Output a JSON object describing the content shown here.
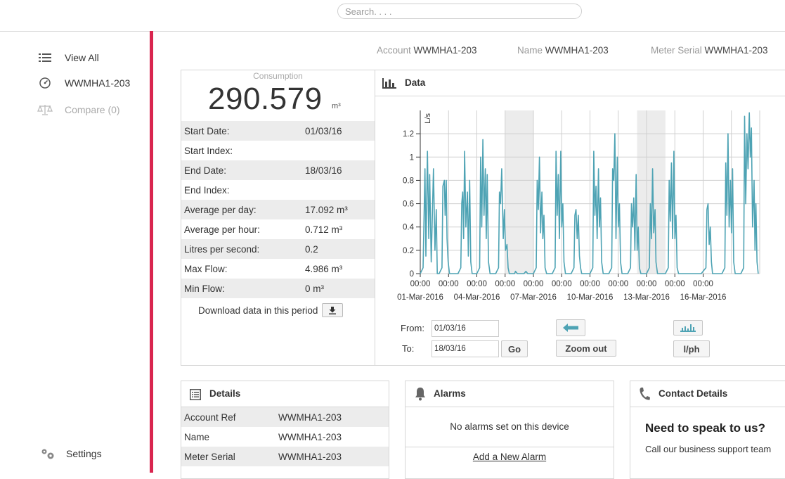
{
  "search": {
    "placeholder": "Search. . . ."
  },
  "sidebar": {
    "items": [
      {
        "label": "View All",
        "icon": "list-icon"
      },
      {
        "label": "WWMHA1-203",
        "icon": "gauge-icon"
      },
      {
        "label": "Compare (0)",
        "icon": "scales-icon"
      }
    ],
    "settings_label": "Settings",
    "accent_color": "#d9254f"
  },
  "meta": {
    "account_label": "Account",
    "account_value": "WWMHA1-203",
    "name_label": "Name",
    "name_value": "WWMHA1-203",
    "serial_label": "Meter Serial",
    "serial_value": "WWMHA1-203"
  },
  "consumption": {
    "label": "Consumption",
    "value": "290.579",
    "unit": "m³",
    "stats": [
      {
        "label": "Start Date:",
        "value": "01/03/16"
      },
      {
        "label": "Start Index:",
        "value": ""
      },
      {
        "label": "End Date:",
        "value": "18/03/16"
      },
      {
        "label": "End Index:",
        "value": ""
      },
      {
        "label": "Average per day:",
        "value": "17.092 m³"
      },
      {
        "label": "Average per hour:",
        "value": "0.712 m³"
      },
      {
        "label": "Litres per second:",
        "value": "0.2"
      },
      {
        "label": "Max Flow:",
        "value": "4.986 m³"
      },
      {
        "label": "Min Flow:",
        "value": "0 m³"
      }
    ],
    "download_label": "Download data in this period"
  },
  "data_panel": {
    "title": "Data",
    "from_label": "From:",
    "from_value": "01/03/16",
    "to_label": "To:",
    "to_value": "18/03/16",
    "go_label": "Go",
    "zoom_out_label": "Zoom out",
    "unit_toggle_label": "l/ph"
  },
  "chart_data": {
    "type": "line",
    "ylabel": "L/s",
    "ylim": [
      0,
      1.4
    ],
    "yticks": [
      0,
      0.2,
      0.4,
      0.6,
      0.8,
      1,
      1.2
    ],
    "xlim": [
      0,
      18
    ],
    "xticks": [
      {
        "top": "00:00",
        "bottom": "01-Mar-2016"
      },
      {
        "top": "00:00",
        "bottom": ""
      },
      {
        "top": "00:00",
        "bottom": "04-Mar-2016"
      },
      {
        "top": "00:00",
        "bottom": ""
      },
      {
        "top": "00:00",
        "bottom": "07-Mar-2016"
      },
      {
        "top": "00:00",
        "bottom": ""
      },
      {
        "top": "00:00",
        "bottom": "10-Mar-2016"
      },
      {
        "top": "00:00",
        "bottom": ""
      },
      {
        "top": "00:00",
        "bottom": "13-Mar-2016"
      },
      {
        "top": "00:00",
        "bottom": ""
      },
      {
        "top": "00:00",
        "bottom": "16-Mar-2016"
      }
    ],
    "weekend_bands": [
      [
        4.5,
        6
      ],
      [
        11.5,
        13
      ]
    ],
    "grid": true,
    "color": "#4ea3b4",
    "series": [
      {
        "values": [
          [
            0,
            0
          ],
          [
            0.15,
            0.05
          ],
          [
            0.25,
            0.9
          ],
          [
            0.3,
            0.15
          ],
          [
            0.38,
            1.05
          ],
          [
            0.45,
            0.3
          ],
          [
            0.5,
            0.85
          ],
          [
            0.58,
            0.1
          ],
          [
            0.7,
            0.9
          ],
          [
            0.78,
            0.2
          ],
          [
            0.85,
            0.55
          ],
          [
            0.9,
            0
          ],
          [
            1.0,
            0
          ],
          [
            1.15,
            0.05
          ],
          [
            1.2,
            0.75
          ],
          [
            1.28,
            0.8
          ],
          [
            1.32,
            0.5
          ],
          [
            1.38,
            0.8
          ],
          [
            1.42,
            0.3
          ],
          [
            1.48,
            0.1
          ],
          [
            1.55,
            0
          ],
          [
            2.0,
            0
          ],
          [
            2.15,
            0.05
          ],
          [
            2.2,
            0.6
          ],
          [
            2.25,
            0.7
          ],
          [
            2.3,
            0.3
          ],
          [
            2.35,
            1.05
          ],
          [
            2.42,
            0.4
          ],
          [
            2.5,
            0.7
          ],
          [
            2.55,
            0.15
          ],
          [
            2.62,
            0.8
          ],
          [
            2.68,
            0.1
          ],
          [
            2.75,
            0
          ],
          [
            3.0,
            0
          ],
          [
            3.15,
            0.05
          ],
          [
            3.2,
            1.0
          ],
          [
            3.26,
            0.4
          ],
          [
            3.32,
            1.15
          ],
          [
            3.38,
            0.5
          ],
          [
            3.45,
            0.9
          ],
          [
            3.5,
            0.3
          ],
          [
            3.55,
            0.85
          ],
          [
            3.62,
            0.1
          ],
          [
            3.7,
            0
          ],
          [
            4.0,
            0
          ],
          [
            4.15,
            0.05
          ],
          [
            4.2,
            0.7
          ],
          [
            4.26,
            0.6
          ],
          [
            4.32,
            0.9
          ],
          [
            4.4,
            0.3
          ],
          [
            4.46,
            0.55
          ],
          [
            4.52,
            0.2
          ],
          [
            4.6,
            0.25
          ],
          [
            4.66,
            0.05
          ],
          [
            4.72,
            0
          ],
          [
            5.0,
            0
          ],
          [
            5.05,
            0.02
          ],
          [
            5.15,
            0
          ],
          [
            5.5,
            0
          ],
          [
            5.6,
            0.02
          ],
          [
            5.7,
            0
          ],
          [
            6.0,
            0
          ],
          [
            6.15,
            0.05
          ],
          [
            6.2,
            0.8
          ],
          [
            6.26,
            0.55
          ],
          [
            6.32,
            1.0
          ],
          [
            6.38,
            0.35
          ],
          [
            6.45,
            0.7
          ],
          [
            6.5,
            0.3
          ],
          [
            6.56,
            0.5
          ],
          [
            6.62,
            0.05
          ],
          [
            6.7,
            0
          ],
          [
            7.0,
            0
          ],
          [
            7.15,
            0.05
          ],
          [
            7.2,
            1.05
          ],
          [
            7.26,
            0.5
          ],
          [
            7.32,
            0.85
          ],
          [
            7.38,
            0.3
          ],
          [
            7.45,
            1.05
          ],
          [
            7.5,
            0.4
          ],
          [
            7.56,
            0.6
          ],
          [
            7.62,
            0.1
          ],
          [
            7.7,
            0
          ],
          [
            8.0,
            0
          ],
          [
            8.15,
            0.05
          ],
          [
            8.2,
            0.5
          ],
          [
            8.26,
            0.55
          ],
          [
            8.32,
            0.3
          ],
          [
            8.38,
            0.5
          ],
          [
            8.44,
            0.15
          ],
          [
            8.5,
            0.05
          ],
          [
            8.56,
            0
          ],
          [
            9.0,
            0
          ],
          [
            9.15,
            0.05
          ],
          [
            9.2,
            1.05
          ],
          [
            9.26,
            0.5
          ],
          [
            9.32,
            0.75
          ],
          [
            9.38,
            0.3
          ],
          [
            9.45,
            0.9
          ],
          [
            9.5,
            0.4
          ],
          [
            9.56,
            0.65
          ],
          [
            9.62,
            0.1
          ],
          [
            9.7,
            0
          ],
          [
            10.0,
            0
          ],
          [
            10.15,
            0.05
          ],
          [
            10.2,
            0.9
          ],
          [
            10.26,
            0.8
          ],
          [
            10.32,
            1.2
          ],
          [
            10.38,
            0.3
          ],
          [
            10.45,
            1.0
          ],
          [
            10.5,
            0.4
          ],
          [
            10.56,
            0.6
          ],
          [
            10.62,
            0.1
          ],
          [
            10.7,
            0
          ],
          [
            11.0,
            0
          ],
          [
            11.15,
            0.05
          ],
          [
            11.2,
            0.6
          ],
          [
            11.26,
            0.4
          ],
          [
            11.32,
            0.65
          ],
          [
            11.38,
            0.2
          ],
          [
            11.45,
            0.85
          ],
          [
            11.5,
            0.2
          ],
          [
            11.56,
            0.4
          ],
          [
            11.62,
            0.05
          ],
          [
            11.7,
            0
          ],
          [
            12.0,
            0
          ],
          [
            12.15,
            0.05
          ],
          [
            12.2,
            0.6
          ],
          [
            12.26,
            0.3
          ],
          [
            12.32,
            0.9
          ],
          [
            12.38,
            0.35
          ],
          [
            12.45,
            0.55
          ],
          [
            12.5,
            0.1
          ],
          [
            12.58,
            0
          ],
          [
            13.0,
            0
          ],
          [
            13.15,
            0.05
          ],
          [
            13.2,
            0.8
          ],
          [
            13.26,
            0.45
          ],
          [
            13.32,
            0.95
          ],
          [
            13.38,
            0.3
          ],
          [
            13.45,
            1.05
          ],
          [
            13.5,
            0.3
          ],
          [
            13.56,
            0.5
          ],
          [
            13.62,
            0.05
          ],
          [
            13.7,
            0
          ],
          [
            14.0,
            0
          ],
          [
            14.1,
            0
          ],
          [
            14.5,
            0
          ],
          [
            14.9,
            0
          ],
          [
            15.15,
            0.05
          ],
          [
            15.2,
            0.55
          ],
          [
            15.26,
            0.6
          ],
          [
            15.32,
            0.25
          ],
          [
            15.38,
            0.4
          ],
          [
            15.44,
            0.1
          ],
          [
            15.5,
            0
          ],
          [
            16.0,
            0
          ],
          [
            16.15,
            0.05
          ],
          [
            16.2,
            0.95
          ],
          [
            16.26,
            0.5
          ],
          [
            16.32,
            1.2
          ],
          [
            16.38,
            0.4
          ],
          [
            16.45,
            0.8
          ],
          [
            16.5,
            0.35
          ],
          [
            16.56,
            0.9
          ],
          [
            16.62,
            0.1
          ],
          [
            16.7,
            0
          ],
          [
            17.0,
            0
          ],
          [
            17.15,
            0.05
          ],
          [
            17.2,
            1.35
          ],
          [
            17.26,
            0.6
          ],
          [
            17.32,
            1.2
          ],
          [
            17.38,
            0.9
          ],
          [
            17.45,
            1.38
          ],
          [
            17.5,
            1.0
          ],
          [
            17.56,
            1.25
          ],
          [
            17.62,
            0.4
          ],
          [
            17.7,
            0.8
          ],
          [
            17.75,
            0.2
          ],
          [
            17.8,
            0.6
          ],
          [
            17.86,
            0.1
          ],
          [
            17.92,
            0
          ]
        ]
      }
    ]
  },
  "details": {
    "title": "Details",
    "rows": [
      {
        "label": "Account Ref",
        "value": "WWMHA1-203"
      },
      {
        "label": "Name",
        "value": "WWMHA1-203"
      },
      {
        "label": "Meter Serial",
        "value": "WWMHA1-203"
      }
    ]
  },
  "alarms": {
    "title": "Alarms",
    "empty_text": "No alarms set on this device",
    "add_label": "Add a New Alarm"
  },
  "contact": {
    "title": "Contact Details",
    "heading": "Need to speak to us?",
    "text": "Call our business support team"
  }
}
